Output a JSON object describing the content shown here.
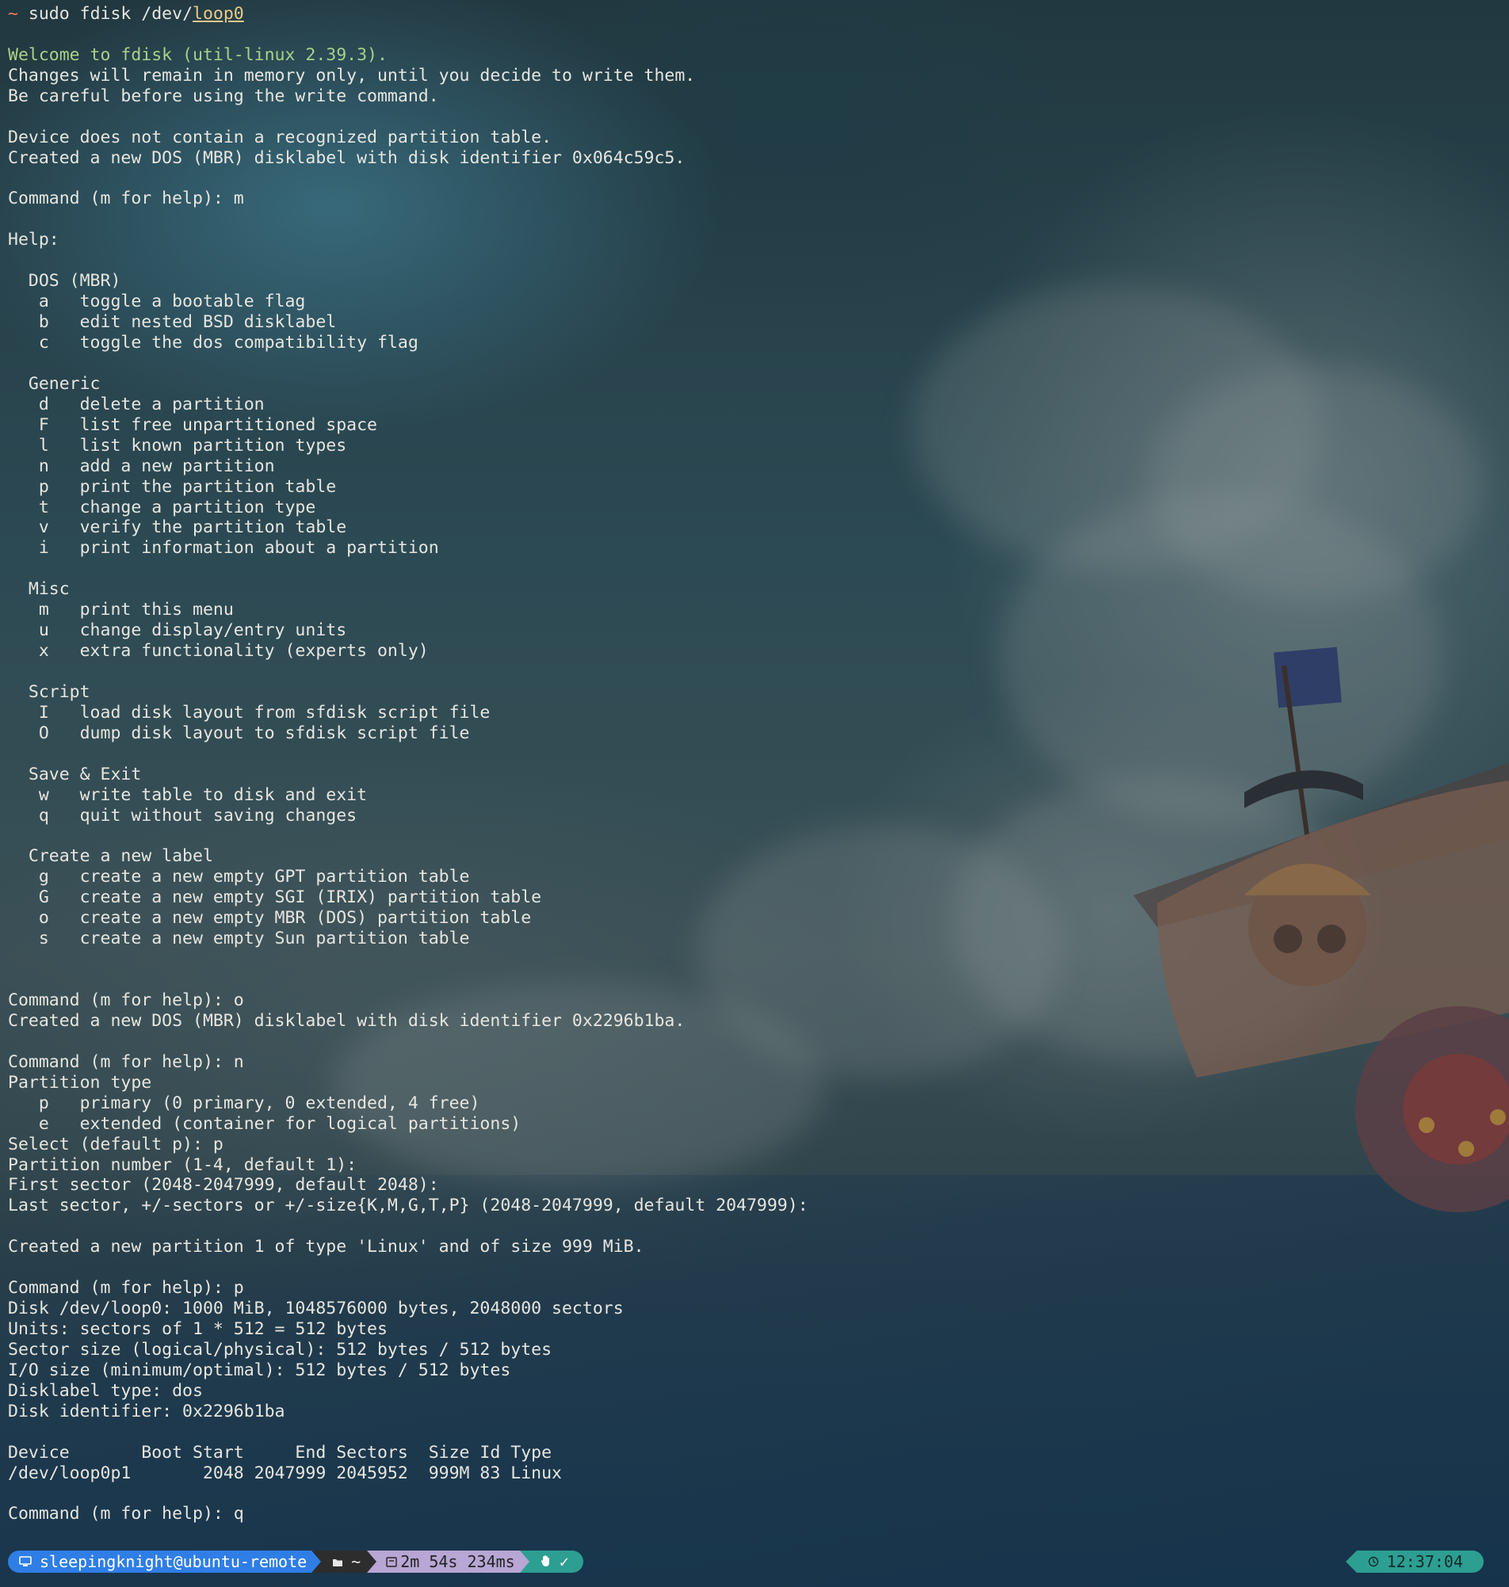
{
  "prompt": {
    "symbol": "~",
    "command": "sudo fdisk /dev/",
    "device": "loop0"
  },
  "terminal_lines": [
    "",
    "Welcome to fdisk (util-linux 2.39.3).",
    "Changes will remain in memory only, until you decide to write them.",
    "Be careful before using the write command.",
    "",
    "Device does not contain a recognized partition table.",
    "Created a new DOS (MBR) disklabel with disk identifier 0x064c59c5.",
    "",
    "Command (m for help): m",
    "",
    "Help:",
    "",
    "  DOS (MBR)",
    "   a   toggle a bootable flag",
    "   b   edit nested BSD disklabel",
    "   c   toggle the dos compatibility flag",
    "",
    "  Generic",
    "   d   delete a partition",
    "   F   list free unpartitioned space",
    "   l   list known partition types",
    "   n   add a new partition",
    "   p   print the partition table",
    "   t   change a partition type",
    "   v   verify the partition table",
    "   i   print information about a partition",
    "",
    "  Misc",
    "   m   print this menu",
    "   u   change display/entry units",
    "   x   extra functionality (experts only)",
    "",
    "  Script",
    "   I   load disk layout from sfdisk script file",
    "   O   dump disk layout to sfdisk script file",
    "",
    "  Save & Exit",
    "   w   write table to disk and exit",
    "   q   quit without saving changes",
    "",
    "  Create a new label",
    "   g   create a new empty GPT partition table",
    "   G   create a new empty SGI (IRIX) partition table",
    "   o   create a new empty MBR (DOS) partition table",
    "   s   create a new empty Sun partition table",
    "",
    "",
    "Command (m for help): o",
    "Created a new DOS (MBR) disklabel with disk identifier 0x2296b1ba.",
    "",
    "Command (m for help): n",
    "Partition type",
    "   p   primary (0 primary, 0 extended, 4 free)",
    "   e   extended (container for logical partitions)",
    "Select (default p): p",
    "Partition number (1-4, default 1):",
    "First sector (2048-2047999, default 2048):",
    "Last sector, +/-sectors or +/-size{K,M,G,T,P} (2048-2047999, default 2047999):",
    "",
    "Created a new partition 1 of type 'Linux' and of size 999 MiB.",
    "",
    "Command (m for help): p",
    "Disk /dev/loop0: 1000 MiB, 1048576000 bytes, 2048000 sectors",
    "Units: sectors of 1 * 512 = 512 bytes",
    "Sector size (logical/physical): 512 bytes / 512 bytes",
    "I/O size (minimum/optimal): 512 bytes / 512 bytes",
    "Disklabel type: dos",
    "Disk identifier: 0x2296b1ba",
    "",
    "Device       Boot Start     End Sectors  Size Id Type",
    "/dev/loop0p1       2048 2047999 2045952  999M 83 Linux",
    "",
    "Command (m for help): q"
  ],
  "status_bar": {
    "user_host": "sleepingknight@ubuntu-remote",
    "directory": "~",
    "duration": "2m 54s 234ms",
    "result": "✓",
    "clock": "12:37:04"
  },
  "icons": {
    "user": "monitor-icon",
    "folder": "folder-icon",
    "timer": "timer-icon",
    "hand": "hand-icon",
    "clock": "clock-icon"
  },
  "colors": {
    "prompt_symbol": "#ef7d5a",
    "welcome": "#a9d189",
    "device_underline": "#e9c98a",
    "user_segment": "#2f7ee6",
    "time_segment": "#b8a6d4",
    "ok_segment": "#2d9e92"
  }
}
